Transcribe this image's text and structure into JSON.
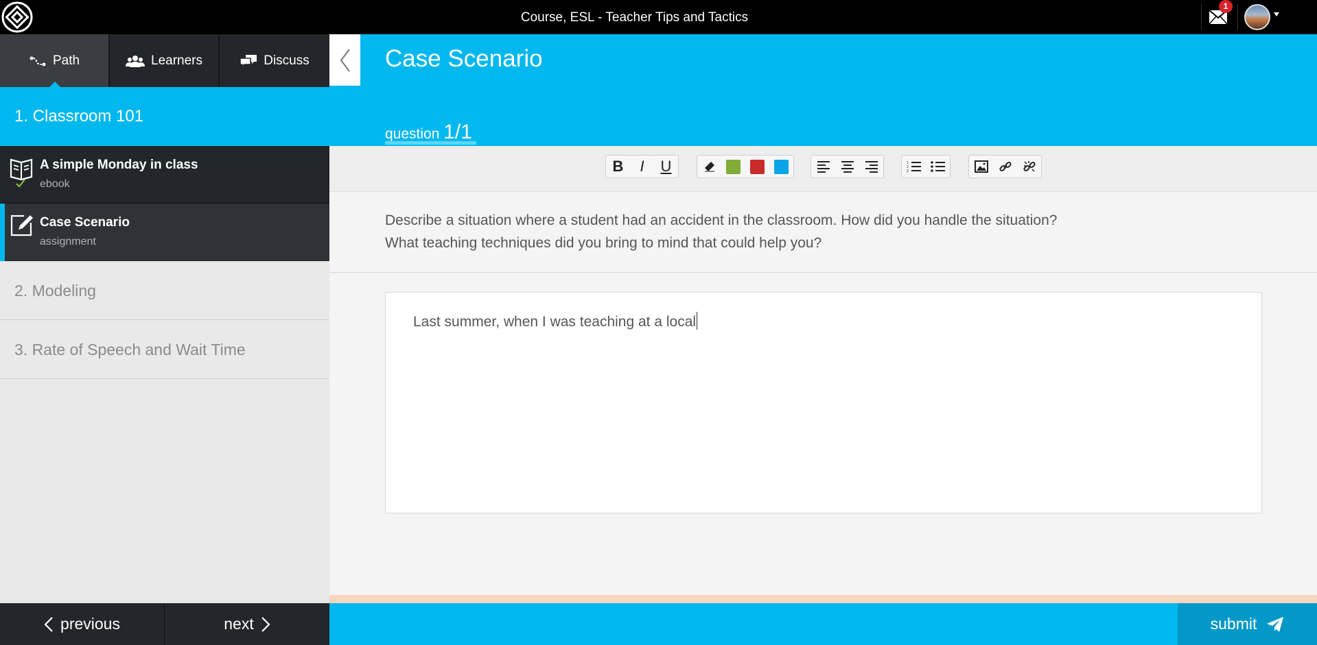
{
  "header": {
    "course_title": "Course, ESL - Teacher Tips and Tactics",
    "notification_count": "1"
  },
  "sidebar": {
    "tabs": [
      {
        "label": "Path",
        "icon": "path-icon",
        "active": true
      },
      {
        "label": "Learners",
        "icon": "learners-icon",
        "active": false
      },
      {
        "label": "Discuss",
        "icon": "discuss-icon",
        "active": false
      }
    ],
    "sections": [
      {
        "title": "1. Classroom 101",
        "expanded": true,
        "items": [
          {
            "title": "A simple Monday in class",
            "type": "ebook",
            "icon": "book-icon",
            "completed": true
          },
          {
            "title": "Case Scenario",
            "type": "assignment",
            "icon": "edit-icon",
            "current": true
          }
        ]
      },
      {
        "title": "2. Modeling",
        "expanded": false
      },
      {
        "title": "3. Rate of Speech and Wait Time",
        "expanded": false
      }
    ],
    "nav": {
      "previous_label": "previous",
      "next_label": "next"
    }
  },
  "main": {
    "title": "Case Scenario",
    "question_label": "question",
    "question_counter": "1/1",
    "toolbar": {
      "bold": "B",
      "italic": "I",
      "underline": "U",
      "colors": [
        "#7fab36",
        "#c92a2a",
        "#0aa5e8"
      ]
    },
    "question_text": "Describe a situation where a student had an accident in the classroom. How did you handle the situation? What teaching techniques did you bring to mind that could help you?",
    "answer_text": "Last summer, when I was teaching at a local",
    "submit_label": "submit"
  },
  "colors": {
    "accent": "#00b8ee",
    "dark": "#23262b",
    "submit_bg": "#0398c7"
  }
}
